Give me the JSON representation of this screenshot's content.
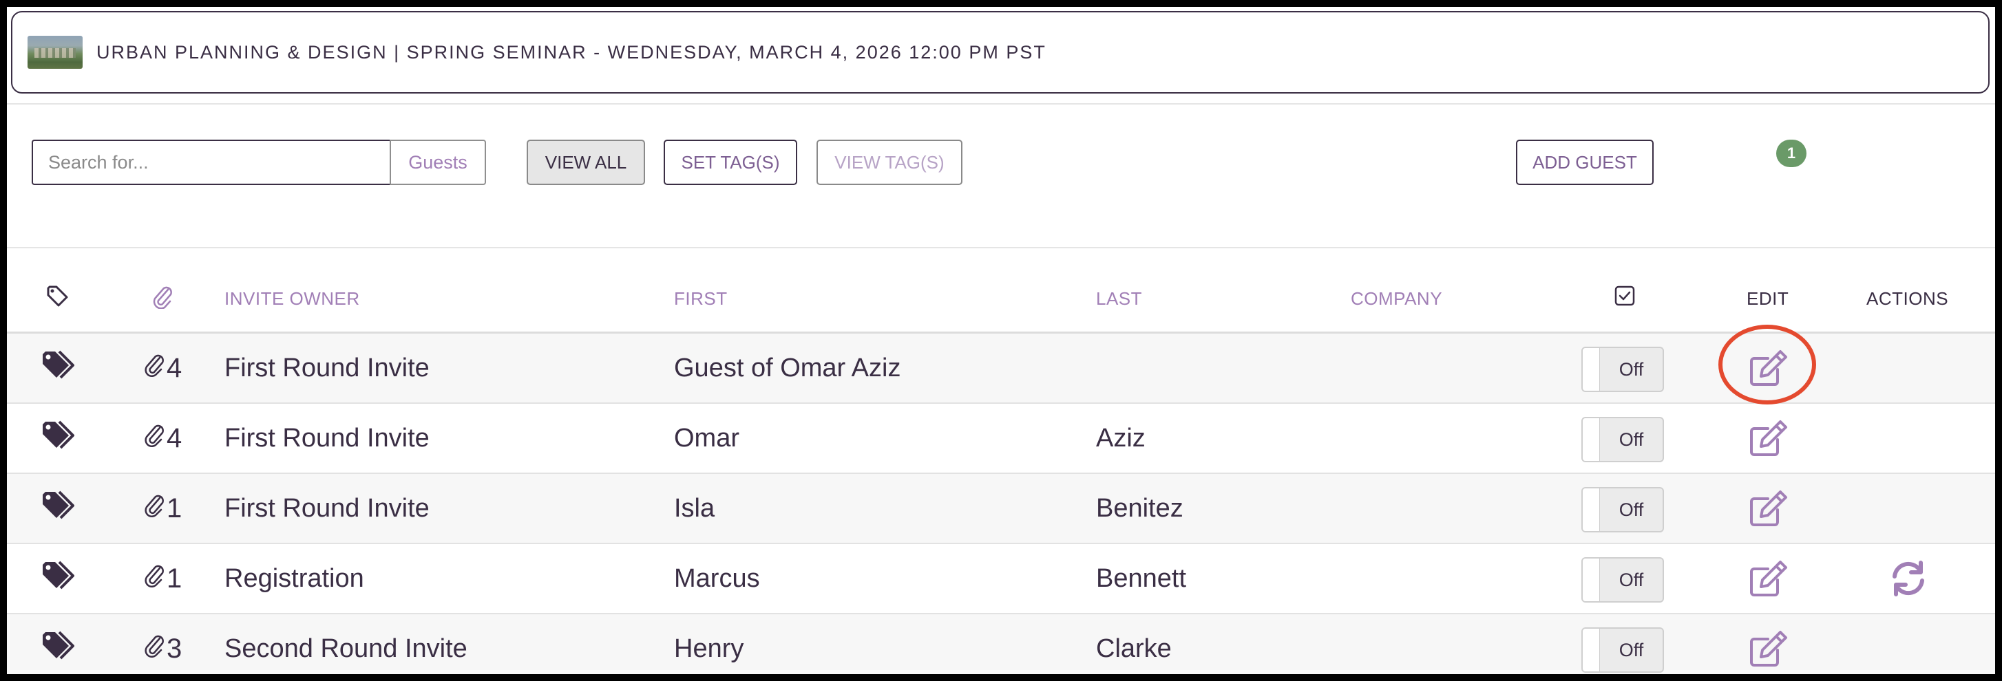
{
  "event": {
    "title": "URBAN PLANNING & DESIGN | SPRING SEMINAR - WEDNESDAY, MARCH 4, 2026 12:00 PM PST"
  },
  "toolbar": {
    "search_placeholder": "Search for...",
    "search_scope": "Guests",
    "view_all": "VIEW ALL",
    "set_tags": "SET TAG(S)",
    "view_tags": "VIEW TAG(S)",
    "add_guest": "ADD GUEST",
    "badge_count": "1"
  },
  "colors": {
    "accent": "#a17fb6",
    "text": "#3a2e44",
    "badge": "#6a9a68",
    "highlight": "#e44a2f"
  },
  "columns": {
    "tags_icon": "tag-icon",
    "attachments_icon": "paperclip-icon",
    "invite_owner": "INVITE OWNER",
    "first": "FIRST",
    "last": "LAST",
    "company": "COMPANY",
    "checked_icon": "checkbox-icon",
    "edit": "EDIT",
    "actions": "ACTIONS"
  },
  "rows": [
    {
      "attachments": "4",
      "invite_owner": "First Round Invite",
      "first": "Guest of Omar Aziz",
      "last": "",
      "company": "",
      "toggle": "Off",
      "has_action": false
    },
    {
      "attachments": "4",
      "invite_owner": "First Round Invite",
      "first": "Omar",
      "last": "Aziz",
      "company": "",
      "toggle": "Off",
      "has_action": false
    },
    {
      "attachments": "1",
      "invite_owner": "First Round Invite",
      "first": "Isla",
      "last": "Benitez",
      "company": "",
      "toggle": "Off",
      "has_action": false
    },
    {
      "attachments": "1",
      "invite_owner": "Registration",
      "first": "Marcus",
      "last": "Bennett",
      "company": "",
      "toggle": "Off",
      "has_action": true
    },
    {
      "attachments": "3",
      "invite_owner": "Second Round Invite",
      "first": "Henry",
      "last": "Clarke",
      "company": "",
      "toggle": "Off",
      "has_action": false
    }
  ]
}
